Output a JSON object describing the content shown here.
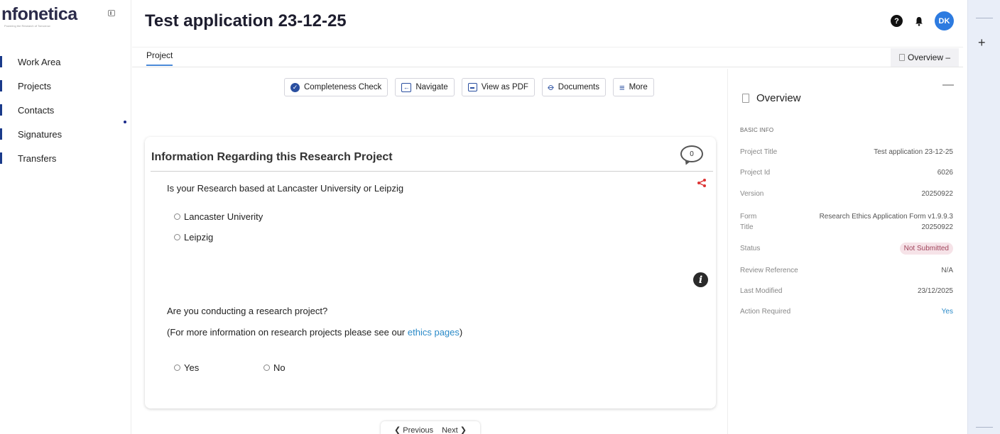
{
  "app": {
    "logo_text": "nfonetica",
    "logo_tagline": "Powering the Research of Tomorrow"
  },
  "sidebar": {
    "items": [
      {
        "label": "Work Area"
      },
      {
        "label": "Projects"
      },
      {
        "label": "Contacts"
      },
      {
        "label": "Signatures"
      },
      {
        "label": "Transfers"
      }
    ]
  },
  "header": {
    "title": "Test application 23-12-25",
    "avatar_initials": "DK"
  },
  "tabs": {
    "project": "Project",
    "overview_toggle": "Overview –"
  },
  "toolbar": {
    "completeness": "Completeness Check",
    "navigate": "Navigate",
    "view_pdf": "View as PDF",
    "documents": "Documents",
    "more": "More"
  },
  "card": {
    "title": "Information Regarding this Research Project",
    "comment_count": "0",
    "q1": "Is your Research based at Lancaster University or Leipzig",
    "q1_options": [
      "Lancaster Univerity",
      "Leipzig"
    ],
    "q2": "Are you conducting a research project?",
    "q2_note_prefix": "(For more information on research projects please see our ",
    "q2_link": "ethics pages",
    "q2_note_suffix": ")",
    "q2_options": [
      "Yes",
      "No"
    ]
  },
  "pager": {
    "previous": "Previous",
    "next": "Next"
  },
  "overview": {
    "title": "Overview",
    "section": "BASIC INFO",
    "rows": [
      {
        "label": "Project Title",
        "value": "Test application 23-12-25"
      },
      {
        "label": "Project Id",
        "value": "6026"
      },
      {
        "label": "Version",
        "value": "20250922"
      },
      {
        "label": "Form Title",
        "value": "Research Ethics Application Form v1.9.9.3 20250922"
      },
      {
        "label": "Status",
        "value": "Not Submitted"
      },
      {
        "label": "Review Reference",
        "value": "N/A"
      },
      {
        "label": "Last Modified",
        "value": "23/12/2025"
      },
      {
        "label": "Action Required",
        "value": "Yes"
      }
    ]
  },
  "colors": {
    "accent": "#2a4fa0",
    "avatar": "#2d7be0",
    "link": "#2a8ac8",
    "status_badge_bg": "#f6e3e8"
  },
  "icons": [
    "collapse-sidebar-icon",
    "help-icon",
    "bell-icon",
    "document-icon",
    "check-circle-icon",
    "navigate-icon",
    "pdf-icon",
    "paperclip-icon",
    "menu-icon",
    "comment-icon",
    "share-icon",
    "info-icon",
    "plus-icon"
  ]
}
